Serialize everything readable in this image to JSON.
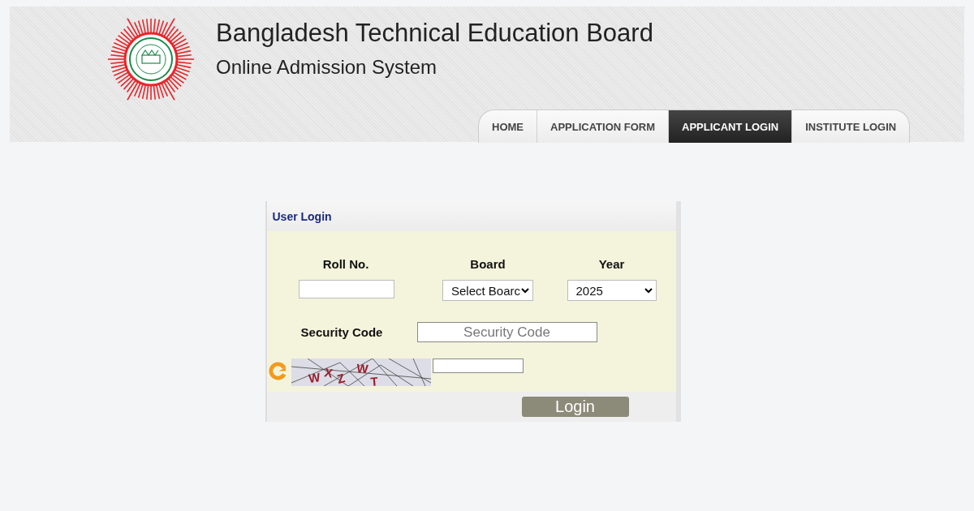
{
  "header": {
    "title": "Bangladesh Technical Education Board",
    "subtitle": "Online Admission System"
  },
  "nav": [
    {
      "label": "HOME",
      "selected": false
    },
    {
      "label": "APPLICATION FORM",
      "selected": false
    },
    {
      "label": "APPLICANT LOGIN",
      "selected": true
    },
    {
      "label": "INSTITUTE LOGIN",
      "selected": false
    }
  ],
  "login": {
    "title": "User Login",
    "fields": [
      {
        "label": "Roll No.",
        "kind": "text"
      },
      {
        "label": "Board",
        "kind": "select",
        "value": "Select Boarc"
      },
      {
        "label": "Year",
        "kind": "select",
        "value": "2025"
      }
    ],
    "security_label": "Security Code",
    "security_placeholder": "Security Code",
    "captcha_letters": [
      "W",
      "X",
      "Z",
      "W",
      "T"
    ],
    "button": "Login"
  }
}
